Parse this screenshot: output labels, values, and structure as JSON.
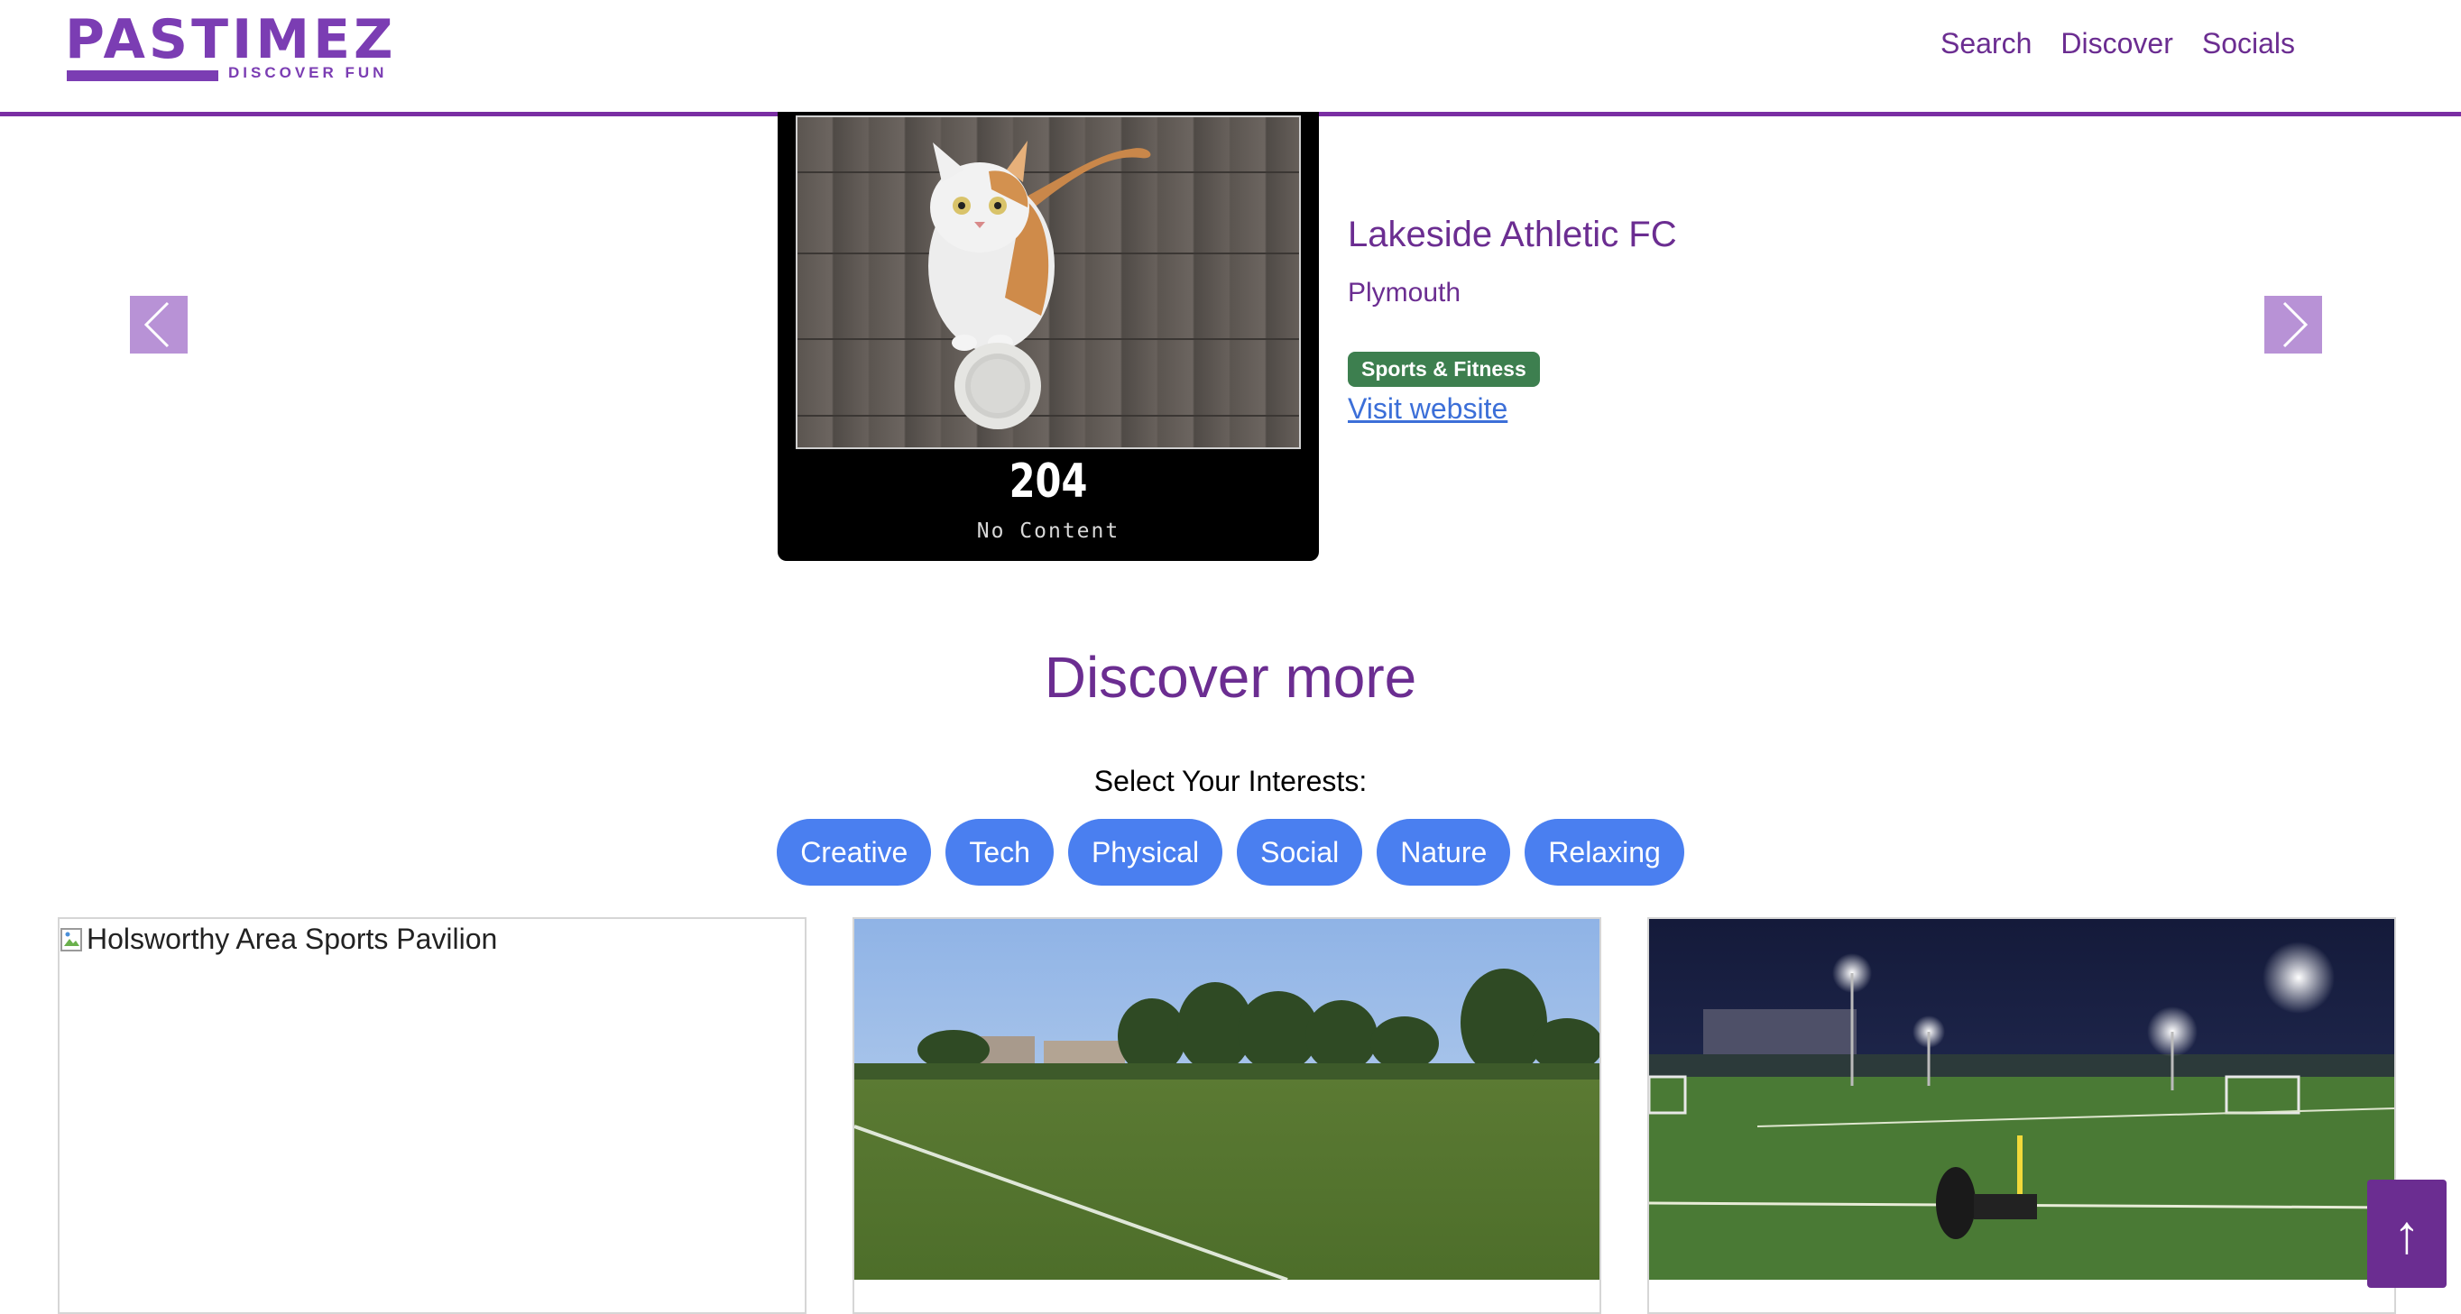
{
  "header": {
    "logo_text": "PASTIMEZ",
    "logo_tagline": "DISCOVER FUN",
    "nav": [
      "Search",
      "Discover",
      "Socials"
    ]
  },
  "featured": {
    "image_status_code": "204",
    "image_status_text": "No Content",
    "name": "Lakeside Athletic FC",
    "location": "Plymouth",
    "category": "Sports & Fitness",
    "link_text": "Visit website"
  },
  "discover": {
    "title": "Discover more",
    "interests_label": "Select Your Interests:",
    "interests": [
      "Creative",
      "Tech",
      "Physical",
      "Social",
      "Nature",
      "Relaxing"
    ]
  },
  "cards": [
    {
      "image_alt": "Holsworthy Area Sports Pavilion"
    }
  ],
  "icons": {
    "prev": "chevron-left-icon",
    "next": "chevron-right-icon",
    "back_to_top": "arrow-up-icon"
  },
  "back_to_top_label": "↑",
  "colors": {
    "brand_purple": "#6b2d91",
    "chip_blue": "#4a7ff0",
    "badge_green": "#3d7f4f",
    "arrow_bg": "#b892d6",
    "link_blue": "#3c6fd8"
  }
}
